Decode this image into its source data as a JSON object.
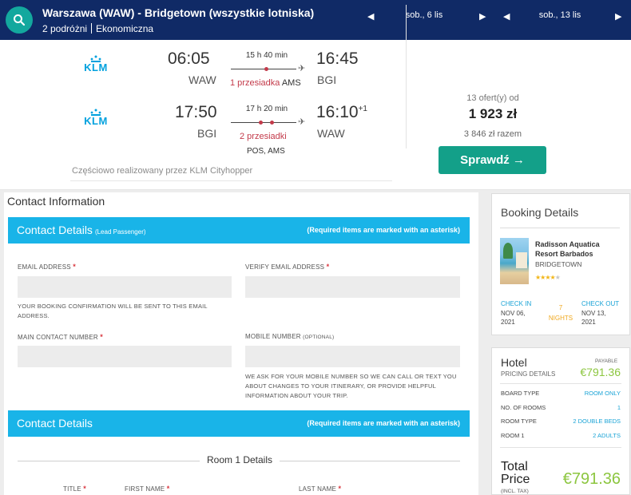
{
  "search": {
    "route": "Warszawa (WAW) - Bridgetown (wszystkie lotniska)",
    "travellers": "2 podróżni",
    "cabin": "Ekonomiczna",
    "depart_date": "sob., 6 lis",
    "return_date": "sob., 13 lis",
    "prev_arrow": "◀",
    "next_arrow": "▶"
  },
  "flight": {
    "airline": "KLM",
    "outbound": {
      "depart_time": "06:05",
      "depart_code": "WAW",
      "duration": "15 h 40 min",
      "stops": "1 przesiadka",
      "via": "AMS",
      "arrive_time": "16:45",
      "arrive_code": "BGI"
    },
    "inbound": {
      "depart_time": "17:50",
      "depart_code": "BGI",
      "duration": "17 h 20 min",
      "stops": "2 przesiadki",
      "via": "POS, AMS",
      "arrive_time": "16:10",
      "day_offset": "+1",
      "arrive_code": "WAW"
    },
    "operated_by": "Częściowo realizowany przez KLM Cityhopper",
    "offers": "13 ofert(y) od",
    "price": "1 923 zł",
    "total": "3 846 zł razem",
    "cta": "Sprawdź →"
  },
  "form": {
    "section_title": "Contact Information",
    "contact_bar": {
      "title": "Contact Details",
      "subtitle": "(Lead Passenger)",
      "required_note": "(Required items are marked with an asterisk)"
    },
    "email_label": "EMAIL ADDRESS",
    "verify_email_label": "VERIFY EMAIL ADDRESS",
    "email_note": "YOUR BOOKING CONFIRMATION WILL BE SENT TO THIS EMAIL ADDRESS.",
    "main_contact_label": "MAIN CONTACT NUMBER",
    "mobile_label": "MOBILE NUMBER",
    "mobile_optional": "(OPTIONAL)",
    "mobile_note": "WE ASK FOR YOUR MOBILE NUMBER SO WE CAN CALL OR TEXT YOU ABOUT CHANGES TO YOUR ITINERARY, OR PROVIDE HELPFUL INFORMATION ABOUT YOUR TRIP.",
    "asterisk": "*",
    "details_bar": {
      "title": "Contact Details",
      "required_note": "(Required items are marked with an asterisk)"
    },
    "room_title": "Room 1 Details",
    "title_label": "TITLE",
    "first_name_label": "FIRST NAME",
    "last_name_label": "LAST NAME"
  },
  "booking": {
    "title": "Booking Details",
    "hotel_name": "Radisson Aquatica Resort Barbados",
    "hotel_city": "BRIDGETOWN",
    "stars_on": "★★★★",
    "stars_off": "★",
    "star_rating": 4,
    "check_in_label": "CHECK IN",
    "check_in_date": "NOV 06, 2021",
    "nights_count": "7",
    "nights_label": "NIGHTS",
    "check_out_label": "CHECK OUT",
    "check_out_date": "NOV 13, 2021"
  },
  "pricing": {
    "title": "Hotel",
    "payable": "PAYABLE",
    "details_label": "PRICING DETAILS",
    "amount": "€791.36",
    "rows": [
      {
        "label": "BOARD TYPE",
        "value": "ROOM ONLY"
      },
      {
        "label": "NO. OF ROOMS",
        "value": "1"
      },
      {
        "label": "ROOM TYPE",
        "value": "2 DOUBLE BEDS"
      },
      {
        "label": "ROOM 1",
        "value": "2 ADULTS"
      }
    ],
    "total_label_1": "Total",
    "total_label_2": "Price",
    "incl_tax": "(INCL. TAX)",
    "total_amount": "€791.36"
  },
  "colors": {
    "topbar": "#102a66",
    "teal": "#13a089",
    "section_blue": "#19b4e8",
    "green_price": "#8cc63f",
    "stop_red": "#c33a4a"
  }
}
